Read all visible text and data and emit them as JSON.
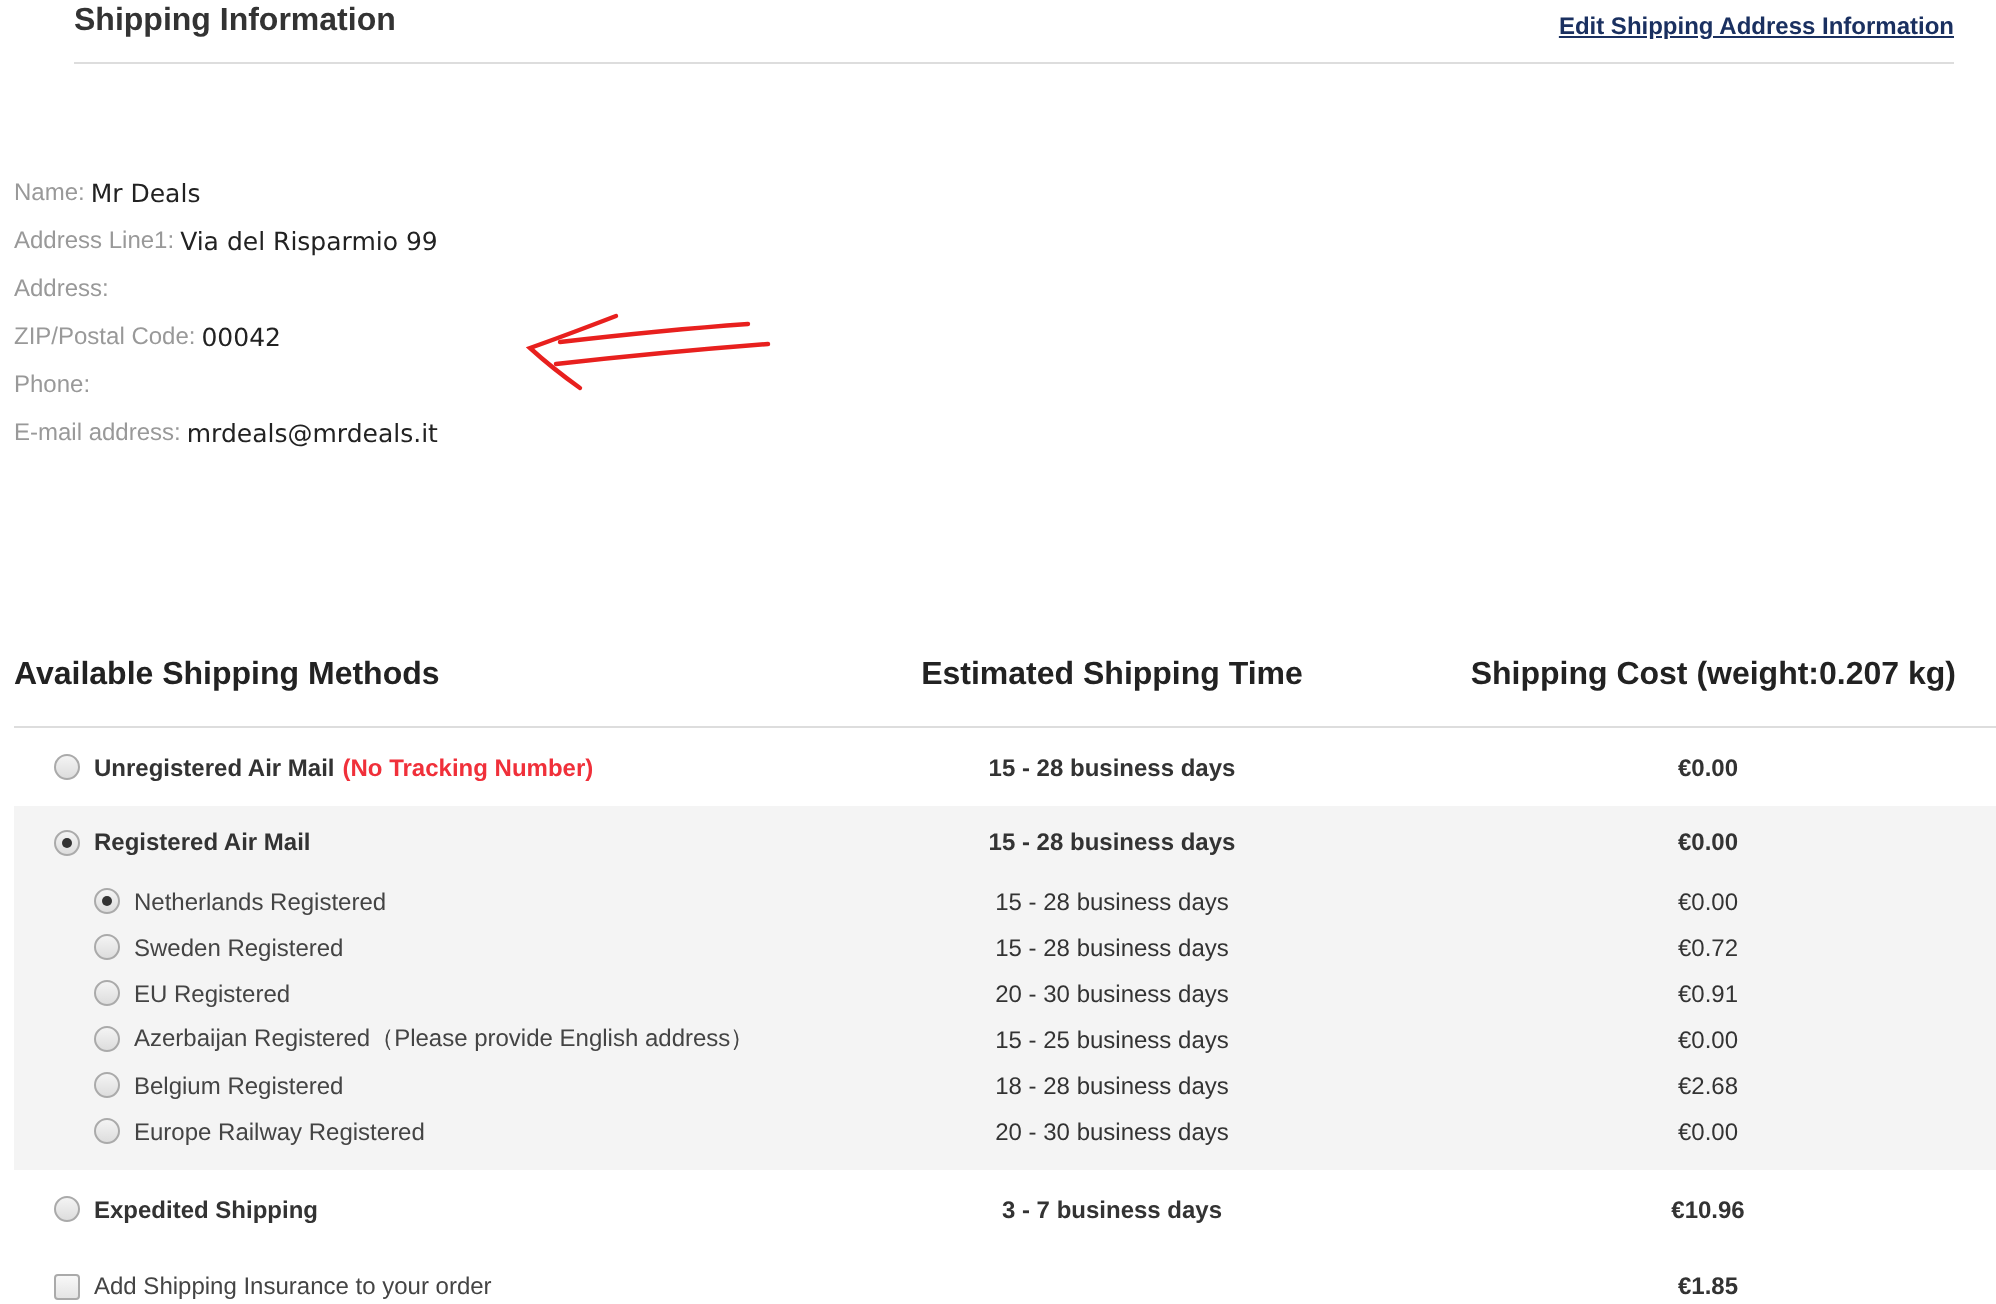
{
  "header": {
    "title": "Shipping Information",
    "edit_link": "Edit Shipping Address Information"
  },
  "address": [
    {
      "label": "Name:",
      "value": "Mr Deals"
    },
    {
      "label": "Address Line1:",
      "value": "Via del Risparmio 99"
    },
    {
      "label": "Address:"
    },
    {
      "label": "ZIP/Postal Code:",
      "value": "00042"
    },
    {
      "label": "Phone:"
    },
    {
      "label": "E-mail address:",
      "value": "mrdeals@mrdeals.it"
    }
  ],
  "table": {
    "columns": [
      "Available Shipping Methods",
      "Estimated Shipping Time",
      "Shipping Cost (weight:0.207 kg)"
    ],
    "rows": [
      {
        "kind": "radio",
        "name": "Unregistered Air Mail",
        "note": "(No Tracking Number)",
        "time": "15 - 28 business days",
        "cost": "€0.00",
        "selected": false
      },
      {
        "kind": "radio",
        "name": "Registered Air Mail",
        "time": "15 - 28 business days",
        "cost": "€0.00",
        "selected": true,
        "children": [
          {
            "name": "Netherlands Registered",
            "time": "15 - 28 business days",
            "cost": "€0.00",
            "selected": true
          },
          {
            "name": "Sweden Registered",
            "time": "15 - 28 business days",
            "cost": "€0.72",
            "selected": false
          },
          {
            "name": "EU Registered",
            "time": "20 - 30 business days",
            "cost": "€0.91",
            "selected": false
          },
          {
            "name": "Azerbaijan Registered（Please provide English address）",
            "time": "15 - 25 business days",
            "cost": "€0.00",
            "selected": false
          },
          {
            "name": "Belgium Registered",
            "time": "18 - 28 business days",
            "cost": "€2.68",
            "selected": false
          },
          {
            "name": "Europe Railway Registered",
            "time": "20 - 30 business days",
            "cost": "€0.00",
            "selected": false
          }
        ]
      },
      {
        "kind": "radio",
        "name": "Expedited Shipping",
        "time": "3 - 7 business days",
        "cost": "€10.96",
        "selected": false
      },
      {
        "kind": "checkbox",
        "name": "Add Shipping Insurance to your order",
        "cost": "€1.85",
        "checked": false
      }
    ]
  }
}
